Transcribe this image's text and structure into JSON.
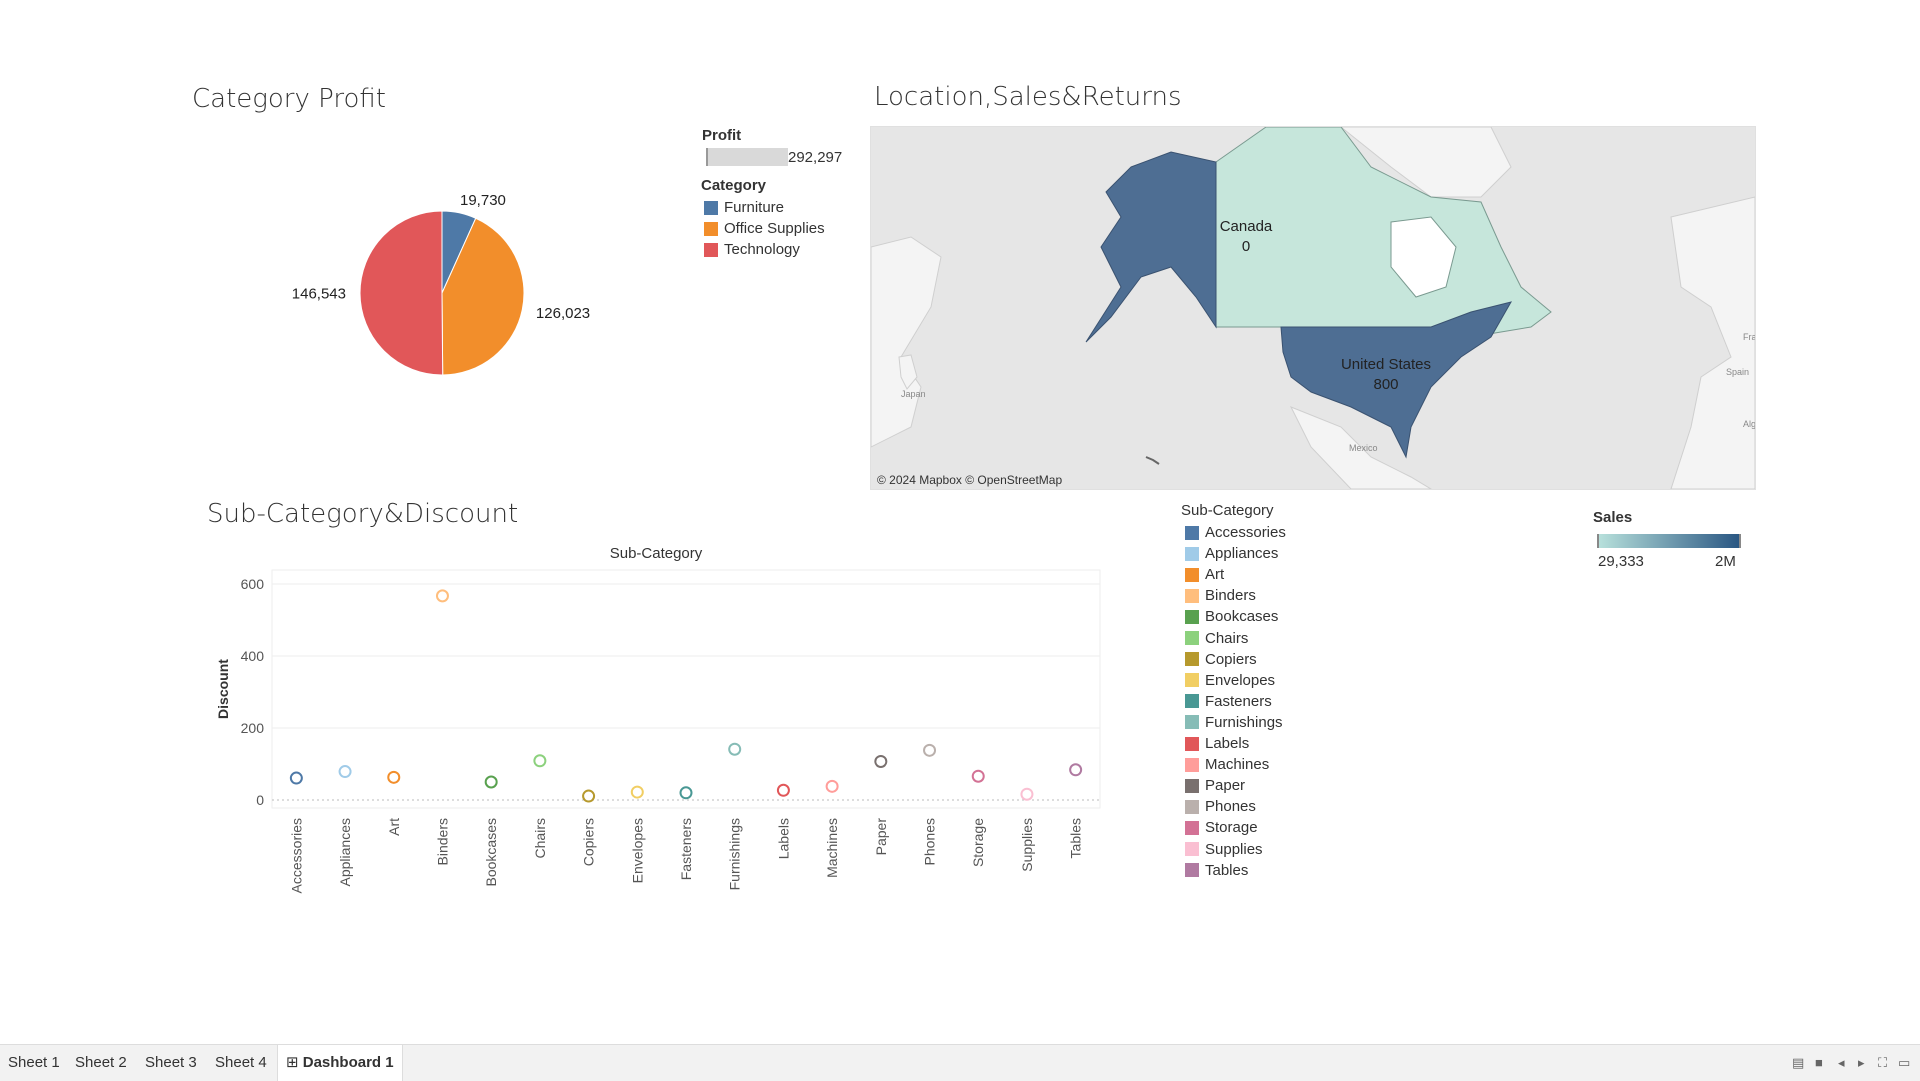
{
  "pie": {
    "title": "Category Profit",
    "chart_data": {
      "type": "pie",
      "labels": [
        "Furniture",
        "Office Supplies",
        "Technology"
      ],
      "values": [
        19730,
        126023,
        146543
      ],
      "value_labels": [
        "19,730",
        "126,023",
        "146,543"
      ],
      "colors": [
        "#4e79a7",
        "#f28e2b",
        "#e15759"
      ]
    }
  },
  "legend_profit": {
    "title": "Profit",
    "value": "292,297"
  },
  "legend_category": {
    "title": "Category",
    "items": [
      {
        "label": "Furniture",
        "color": "#4e79a7"
      },
      {
        "label": "Office Supplies",
        "color": "#f28e2b"
      },
      {
        "label": "Technology",
        "color": "#e15759"
      }
    ]
  },
  "map": {
    "title": "Location,Sales&Returns",
    "regions": [
      {
        "name": "Canada",
        "value": "0"
      },
      {
        "name": "United States",
        "value": "800"
      }
    ],
    "small_labels": [
      "Japan",
      "Mexico",
      "Spain",
      "Fra",
      "Alg"
    ],
    "attribution": "© 2024 Mapbox © OpenStreetMap",
    "colors": {
      "canada": "#c6e6db",
      "usa": "#4e6e93",
      "land": "#f4f4f4",
      "water": "#e6e6e6"
    }
  },
  "legend_sales": {
    "title": "Sales",
    "min_label": "29,333",
    "max_label": "2M",
    "gradient": [
      "#b7e0db",
      "#2a5783"
    ]
  },
  "scatter": {
    "title": "Sub-Category&Discount",
    "chart_data": {
      "type": "scatter",
      "title": "Sub-Category",
      "ylabel": "Discount",
      "ylim": [
        0,
        600
      ],
      "yticks": [
        "600",
        "400",
        "200",
        "0"
      ],
      "categories": [
        "Accessories",
        "Appliances",
        "Art",
        "Binders",
        "Bookcases",
        "Chairs",
        "Copiers",
        "Envelopes",
        "Fasteners",
        "Furnishings",
        "Labels",
        "Machines",
        "Paper",
        "Phones",
        "Storage",
        "Supplies",
        "Tables"
      ],
      "values": [
        61,
        79,
        63,
        567,
        50,
        109,
        11,
        22,
        20,
        141,
        27,
        38,
        107,
        138,
        66,
        16,
        84
      ],
      "colors": [
        "#4e79a7",
        "#a0cbe8",
        "#f28e2b",
        "#ffbe7d",
        "#59a14f",
        "#8cd17d",
        "#b6992d",
        "#f1ce63",
        "#499894",
        "#86bcb6",
        "#e15759",
        "#ff9d9a",
        "#79706e",
        "#bab0ac",
        "#d37295",
        "#fabfd2",
        "#b07aa1"
      ]
    }
  },
  "legend_subcategory": {
    "title": "Sub-Category",
    "items": [
      {
        "label": "Accessories",
        "color": "#4e79a7"
      },
      {
        "label": "Appliances",
        "color": "#a0cbe8"
      },
      {
        "label": "Art",
        "color": "#f28e2b"
      },
      {
        "label": "Binders",
        "color": "#ffbe7d"
      },
      {
        "label": "Bookcases",
        "color": "#59a14f"
      },
      {
        "label": "Chairs",
        "color": "#8cd17d"
      },
      {
        "label": "Copiers",
        "color": "#b6992d"
      },
      {
        "label": "Envelopes",
        "color": "#f1ce63"
      },
      {
        "label": "Fasteners",
        "color": "#499894"
      },
      {
        "label": "Furnishings",
        "color": "#86bcb6"
      },
      {
        "label": "Labels",
        "color": "#e15759"
      },
      {
        "label": "Machines",
        "color": "#ff9d9a"
      },
      {
        "label": "Paper",
        "color": "#79706e"
      },
      {
        "label": "Phones",
        "color": "#bab0ac"
      },
      {
        "label": "Storage",
        "color": "#d37295"
      },
      {
        "label": "Supplies",
        "color": "#fabfd2"
      },
      {
        "label": "Tables",
        "color": "#b07aa1"
      }
    ]
  },
  "tabs": [
    {
      "label": "Sheet 1",
      "active": false
    },
    {
      "label": "Sheet 2",
      "active": false
    },
    {
      "label": "Sheet 3",
      "active": false
    },
    {
      "label": "Sheet 4",
      "active": false
    },
    {
      "label": "Dashboard 1",
      "active": true,
      "icon": "dashboard-icon"
    }
  ],
  "toolbar_icons": [
    "grid-view-icon",
    "filmstrip-view-icon",
    "prev-sheet-icon",
    "next-sheet-icon",
    "fit-screen-icon",
    "presentation-mode-icon"
  ]
}
